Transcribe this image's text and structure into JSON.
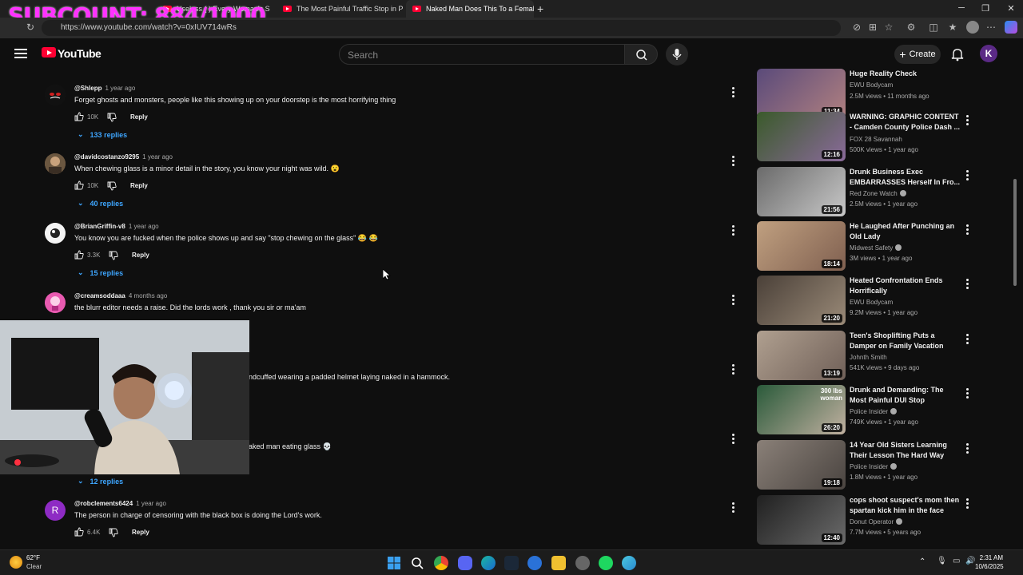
{
  "overlay": {
    "subcount": "SUBCOUNT: 884/1000"
  },
  "browser": {
    "tabs": [
      {
        "title": "Useless (  ) Every Woman's S",
        "active": false
      },
      {
        "title": "The Most Painful Traffic Stop in P",
        "active": false
      },
      {
        "title": "Naked Man Does This To a Femal",
        "active": true
      }
    ],
    "url": "https://www.youtube.com/watch?v=0xIUV714wRs"
  },
  "youtube": {
    "wordmark": "YouTube",
    "search_placeholder": "Search",
    "create_label": "Create",
    "avatar_letter": "K"
  },
  "comments": [
    {
      "author": "@Shlepp",
      "time": "1 year ago",
      "text": "Forget ghosts and monsters, people like this showing up on your doorstep is the most horrifying thing",
      "likes": "10K",
      "reply": "Reply",
      "replies": "133 replies",
      "avatar_color": "#1a1a1a"
    },
    {
      "author": "@davidcostanzo9295",
      "time": "1 year ago",
      "text": "When chewing glass is a minor detail in the story, you know your night was wild. 😮",
      "likes": "10K",
      "reply": "Reply",
      "replies": "40 replies",
      "avatar_color": "#8a6a4a"
    },
    {
      "author": "@BrianGriffin-v8",
      "time": "1 year ago",
      "text": "You know you are fucked when the police shows up and say \"stop chewing on the glass\" 😂 😂",
      "likes": "3.3K",
      "reply": "Reply",
      "replies": "15 replies",
      "avatar_color": "#e8e8e8"
    },
    {
      "author": "@creamsoddaaa",
      "time": "4 months ago",
      "text": "the blurr editor needs a raise. Did the lords work , thank you sir or ma'am",
      "likes": "",
      "reply": "",
      "replies": "",
      "avatar_color": "#d04aa0"
    },
    {
      "author": "",
      "time": "",
      "text": "ndcuffed wearing a padded helmet laying naked in a hammock.",
      "likes": "",
      "reply": "",
      "replies": "",
      "avatar_color": ""
    },
    {
      "author": "",
      "time": "",
      "text": "aked man eating glass 💀",
      "likes": "",
      "reply": "",
      "replies": "12 replies",
      "avatar_color": ""
    },
    {
      "author": "@robclements6424",
      "time": "1 year ago",
      "text": "The person in charge of censoring with the black box is doing the Lord's work.",
      "likes": "6.4K",
      "reply": "Reply",
      "replies": "",
      "avatar_color": "#8e2bc4",
      "avatar_letter": "R"
    }
  ],
  "recommendations": [
    {
      "title": "Huge Reality Check",
      "channel": "EWU Bodycam",
      "verified": false,
      "meta": "2.5M views • 11 months ago",
      "duration": "11:34",
      "thumb_color": "#6a5a8a"
    },
    {
      "title": "WARNING: GRAPHIC CONTENT - Camden County Police Dash ...",
      "channel": "FOX 28 Savannah",
      "verified": false,
      "meta": "500K views • 1 year ago",
      "duration": "12:16",
      "thumb_color": "#4a6a3a"
    },
    {
      "title": "Drunk Business Exec EMBARRASSES Herself In Fro...",
      "channel": "Red Zone Watch",
      "verified": true,
      "meta": "2.5M views • 1 year ago",
      "duration": "21:56",
      "thumb_color": "#8a8a8a"
    },
    {
      "title": "He Laughed After Punching an Old Lady",
      "channel": "Midwest Safety",
      "verified": true,
      "meta": "3M views • 1 year ago",
      "duration": "18:14",
      "thumb_color": "#b09070"
    },
    {
      "title": "Heated Confrontation Ends Horrifically",
      "channel": "EWU Bodycam",
      "verified": false,
      "meta": "9.2M views • 1 year ago",
      "duration": "21:20",
      "thumb_color": "#5a5048"
    },
    {
      "title": "Teen's Shoplifting Puts a Damper on Family Vacation",
      "channel": "Johnth Smith",
      "verified": false,
      "meta": "541K views • 9 days ago",
      "duration": "13:19",
      "thumb_color": "#a09080"
    },
    {
      "title": "Drunk and Demanding: The Most Painful DUI Stop",
      "channel": "Police Insider",
      "verified": true,
      "meta": "749K views • 1 year ago",
      "duration": "26:20",
      "thumb_color": "#3a6a4a",
      "overlay_text": "300 lbs woman"
    },
    {
      "title": "14 Year Old Sisters Learning Their Lesson The Hard Way",
      "channel": "Police Insider",
      "verified": true,
      "meta": "1.8M views • 1 year ago",
      "duration": "19:18",
      "thumb_color": "#7a7068"
    },
    {
      "title": "cops shoot suspect's mom then spartan kick him in the face",
      "channel": "Donut Operator",
      "verified": true,
      "meta": "7.7M views • 5 years ago",
      "duration": "12:40",
      "thumb_color": "#3a3a3a"
    }
  ],
  "taskbar": {
    "weather_temp": "62°F",
    "weather_cond": "Clear",
    "time": "2:31 AM",
    "date": "10/6/2025"
  }
}
